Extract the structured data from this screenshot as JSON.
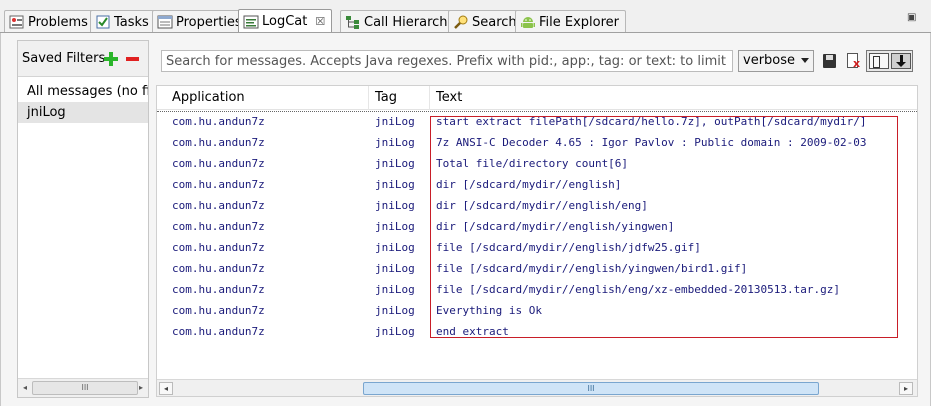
{
  "tabs": [
    {
      "label": "Problems",
      "icon": "problems-icon",
      "active": false
    },
    {
      "label": "Tasks",
      "icon": "tasks-icon",
      "active": false
    },
    {
      "label": "Properties",
      "icon": "properties-icon",
      "active": false
    },
    {
      "label": "LogCat",
      "icon": "logcat-icon",
      "active": true,
      "close": "☒"
    },
    {
      "label": "Call Hierarchy",
      "icon": "call-hierarchy-icon",
      "active": false
    },
    {
      "label": "Search",
      "icon": "search-icon",
      "active": false
    },
    {
      "label": "File Explorer",
      "icon": "android-icon",
      "active": false
    }
  ],
  "view_menu_glyph": "▣",
  "filters": {
    "title": "Saved Filters",
    "items": [
      "All messages (no filters)",
      "jniLog"
    ],
    "selected": "jniLog",
    "scroll_glyph": "III"
  },
  "search": {
    "placeholder": "Search for messages. Accepts Java regexes. Prefix with pid:, app:, tag: or text: to limit scope.",
    "value": ""
  },
  "log_level": {
    "selected": "verbose"
  },
  "log": {
    "columns": [
      "Application",
      "Tag",
      "Text"
    ],
    "rows": [
      {
        "app": "com.hu.andun7z",
        "tag": "jniLog",
        "text": "start extract filePath[/sdcard/hello.7z], outPath[/sdcard/mydir/]"
      },
      {
        "app": "com.hu.andun7z",
        "tag": "jniLog",
        "text": "7z ANSI-C Decoder 4.65 : Igor Pavlov : Public domain : 2009-02-03"
      },
      {
        "app": "com.hu.andun7z",
        "tag": "jniLog",
        "text": "Total file/directory count[6]"
      },
      {
        "app": "com.hu.andun7z",
        "tag": "jniLog",
        "text": "dir [/sdcard/mydir//english]"
      },
      {
        "app": "com.hu.andun7z",
        "tag": "jniLog",
        "text": "dir [/sdcard/mydir//english/eng]"
      },
      {
        "app": "com.hu.andun7z",
        "tag": "jniLog",
        "text": "dir [/sdcard/mydir//english/yingwen]"
      },
      {
        "app": "com.hu.andun7z",
        "tag": "jniLog",
        "text": "file [/sdcard/mydir//english/jdfw25.gif]"
      },
      {
        "app": "com.hu.andun7z",
        "tag": "jniLog",
        "text": "file [/sdcard/mydir//english/yingwen/bird1.gif]"
      },
      {
        "app": "com.hu.andun7z",
        "tag": "jniLog",
        "text": "file [/sdcard/mydir//english/eng/xz-embedded-20130513.tar.gz]"
      },
      {
        "app": "com.hu.andun7z",
        "tag": "jniLog",
        "text": "Everything is Ok"
      },
      {
        "app": "com.hu.andun7z",
        "tag": "jniLog",
        "text": "end extract"
      }
    ],
    "scroll_glyph": "III",
    "scroll_left": "◂",
    "scroll_right": "▸"
  },
  "colors": {
    "highlight": "#c81e28",
    "log_text": "#1a1a7a",
    "add": "#2ab52a",
    "remove": "#e02020"
  }
}
